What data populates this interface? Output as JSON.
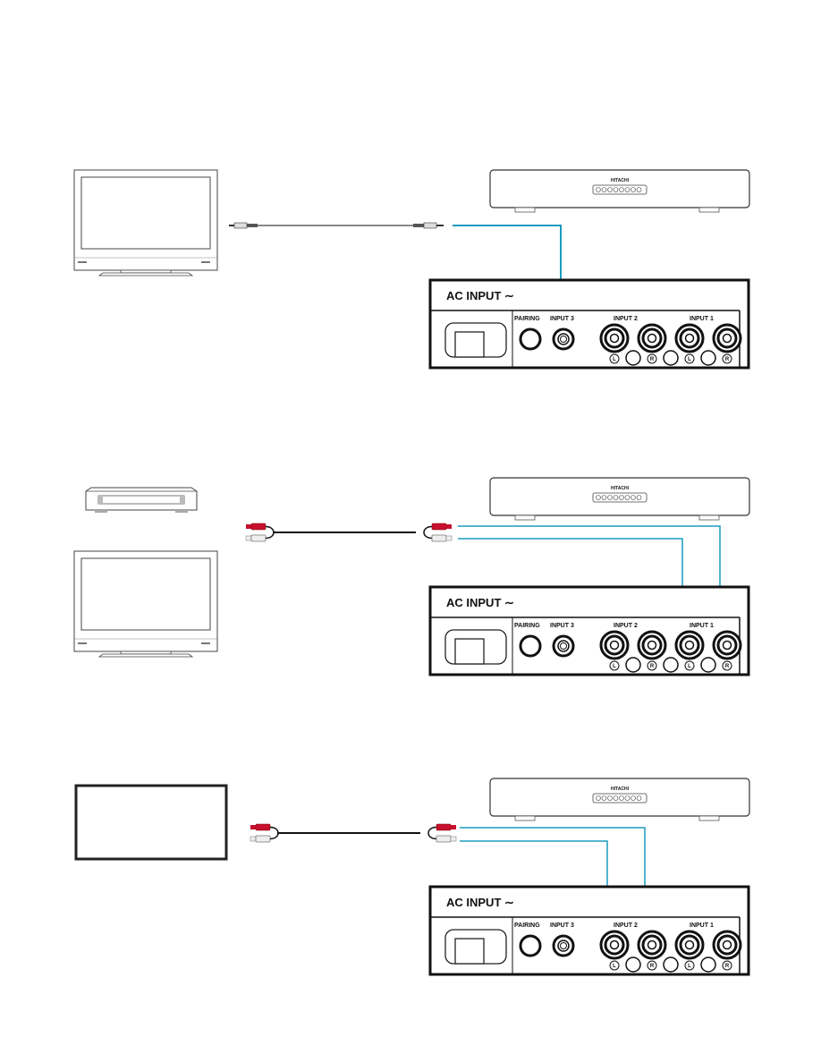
{
  "page": {
    "header_rule": true
  },
  "colors": {
    "cable": "#1a9bbf",
    "rule": "#222222",
    "red_plug": "#c8102e",
    "white_plug": "#dddddd"
  },
  "panel": {
    "ac_input_label": "AC INPUT ∼",
    "pairing_label": "PAIRING",
    "input3_label": "INPUT 3",
    "input2_label": "INPUT 2",
    "input1_label": "INPUT 1",
    "jack_labels": [
      "L",
      "R",
      "L",
      "R"
    ]
  },
  "speaker": {
    "brand": "HITACHI"
  },
  "diagrams": [
    {
      "source": "tv",
      "cable": "3.5mm stereo mini-plug cable",
      "connected_to": [
        "INPUT 3"
      ]
    },
    {
      "source": "player-and-tv",
      "cable": "RCA audio cable",
      "connected_to": [
        "INPUT 1 L",
        "INPUT 1 R"
      ]
    },
    {
      "source": "other-device",
      "cable": "RCA audio cable",
      "connected_to": [
        "INPUT 2 L",
        "INPUT 2 R"
      ]
    }
  ]
}
